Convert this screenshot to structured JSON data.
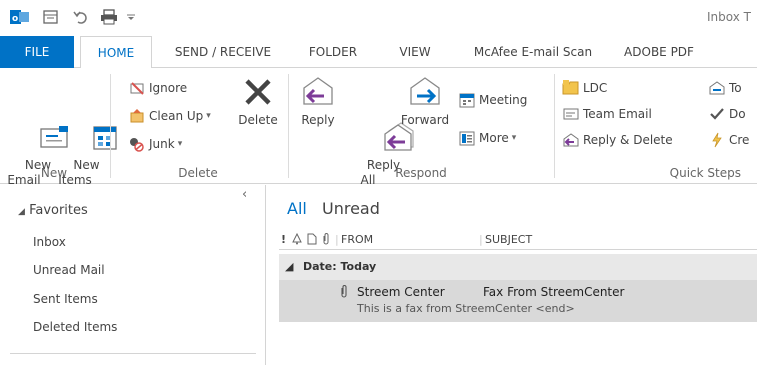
{
  "window": {
    "title": "Inbox T"
  },
  "tabs": [
    {
      "label": "FILE"
    },
    {
      "label": "HOME"
    },
    {
      "label": "SEND / RECEIVE"
    },
    {
      "label": "FOLDER"
    },
    {
      "label": "VIEW"
    },
    {
      "label": "McAfee E-mail Scan"
    },
    {
      "label": "ADOBE PDF"
    }
  ],
  "ribbon": {
    "new_group": {
      "label": "New",
      "new_email": "New\nEmail",
      "new_items": "New\nItems"
    },
    "delete_group": {
      "label": "Delete",
      "ignore": "Ignore",
      "clean_up": "Clean Up",
      "junk": "Junk",
      "delete": "Delete"
    },
    "respond_group": {
      "label": "Respond",
      "reply": "Reply",
      "reply_all": "Reply\nAll",
      "forward": "Forward",
      "meeting": "Meeting",
      "more": "More"
    },
    "quick_steps_group": {
      "label": "Quick Steps",
      "ldc": "LDC",
      "team_email": "Team Email",
      "reply_delete": "Reply & Delete",
      "to": "To",
      "done": "Do",
      "create": "Cre"
    }
  },
  "nav": {
    "favorites": "Favorites",
    "items": [
      {
        "label": "Inbox"
      },
      {
        "label": "Unread Mail"
      },
      {
        "label": "Sent Items"
      },
      {
        "label": "Deleted Items"
      }
    ]
  },
  "list": {
    "filters": {
      "all": "All",
      "unread": "Unread"
    },
    "columns": {
      "from": "FROM",
      "subject": "SUBJECT"
    },
    "group_header": "Date: Today",
    "messages": [
      {
        "from": "Streem Center",
        "subject": "Fax From StreemCenter",
        "preview": "This is a fax from StreemCenter <end>"
      }
    ]
  },
  "colors": {
    "accent": "#0072c6",
    "selected_row": "#d9d9d9",
    "group_band": "#e8e8e8"
  }
}
